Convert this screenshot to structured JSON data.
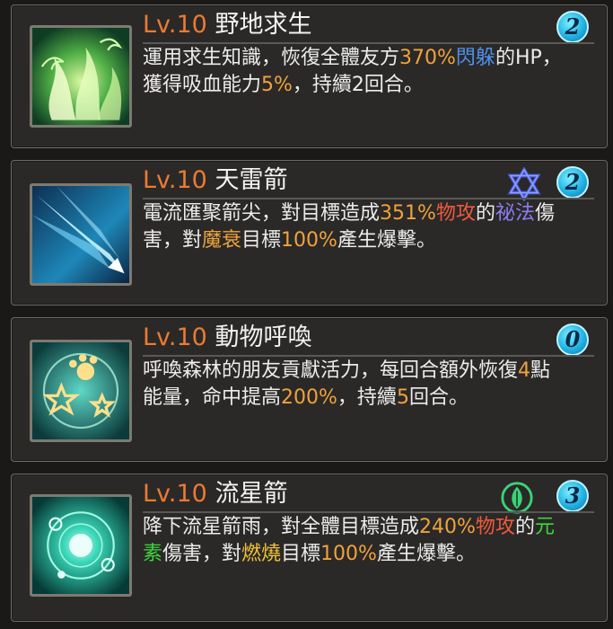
{
  "skills": [
    {
      "level": "Lv.10",
      "name": "野地求生",
      "cost": "2",
      "element_icon": null,
      "desc_segments": [
        {
          "t": "運用求生知識，恢復全體友方",
          "c": ""
        },
        {
          "t": "370%",
          "c": "o"
        },
        {
          "t": "閃躲",
          "c": "b"
        },
        {
          "t": "的HP，獲得吸血能力",
          "c": ""
        },
        {
          "t": "5%",
          "c": "o"
        },
        {
          "t": "，持續2回合。",
          "c": ""
        }
      ]
    },
    {
      "level": "Lv.10",
      "name": "天雷箭",
      "cost": "2",
      "element_icon": "star-of-david-icon",
      "desc_segments": [
        {
          "t": "電流匯聚箭尖，對目標造成",
          "c": ""
        },
        {
          "t": "351%",
          "c": "o"
        },
        {
          "t": "物攻",
          "c": "r"
        },
        {
          "t": "的",
          "c": ""
        },
        {
          "t": "祕法",
          "c": "p"
        },
        {
          "t": "傷害，對",
          "c": ""
        },
        {
          "t": "魔衰",
          "c": "o"
        },
        {
          "t": "目標",
          "c": ""
        },
        {
          "t": "100%",
          "c": "o"
        },
        {
          "t": "產生爆擊。",
          "c": ""
        }
      ]
    },
    {
      "level": "Lv.10",
      "name": "動物呼喚",
      "cost": "0",
      "element_icon": null,
      "desc_segments": [
        {
          "t": "呼喚森林的朋友貢獻活力，每回合額外恢復",
          "c": ""
        },
        {
          "t": "4",
          "c": "o"
        },
        {
          "t": "點能量，命中提高",
          "c": ""
        },
        {
          "t": "200%",
          "c": "o"
        },
        {
          "t": "，持續",
          "c": ""
        },
        {
          "t": "5",
          "c": "o"
        },
        {
          "t": "回合。",
          "c": ""
        }
      ]
    },
    {
      "level": "Lv.10",
      "name": "流星箭",
      "cost": "3",
      "element_icon": "leaf-element-icon",
      "desc_segments": [
        {
          "t": "降下流星箭雨，對全體目標造成",
          "c": ""
        },
        {
          "t": "240%",
          "c": "o"
        },
        {
          "t": "物攻",
          "c": "r"
        },
        {
          "t": "的",
          "c": ""
        },
        {
          "t": "元素",
          "c": "g"
        },
        {
          "t": "傷害，對",
          "c": ""
        },
        {
          "t": "燃燒",
          "c": "y"
        },
        {
          "t": "目標",
          "c": ""
        },
        {
          "t": "100%",
          "c": "o"
        },
        {
          "t": "產生爆擊。",
          "c": ""
        }
      ]
    }
  ],
  "colors": {
    "level": "#ec7a33",
    "value": "#f0a23c",
    "physical": "#ee5a3b",
    "dodge": "#4e90ee",
    "arcane": "#8d7df2",
    "elemental": "#3ed63a",
    "burn": "#f0c23a",
    "badge": "#21b3e3"
  }
}
